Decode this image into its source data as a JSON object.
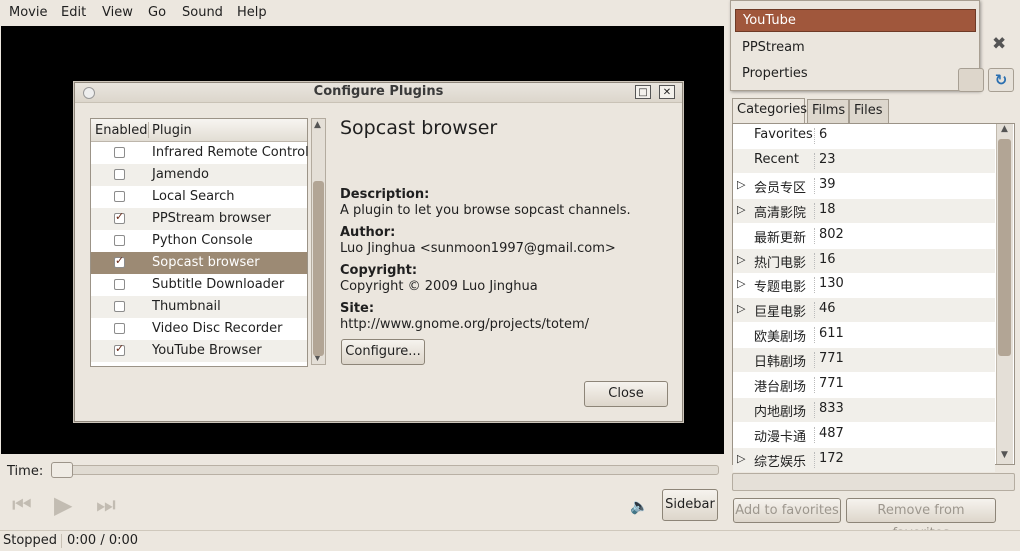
{
  "menubar": {
    "items": [
      "Movie",
      "Edit",
      "View",
      "Go",
      "Sound",
      "Help"
    ]
  },
  "dialog": {
    "title": "Configure Plugins",
    "list_headers": {
      "enabled": "Enabled",
      "plugin": "Plugin"
    },
    "plugins": [
      {
        "name": "Infrared Remote Control",
        "enabled": false
      },
      {
        "name": "Jamendo",
        "enabled": false
      },
      {
        "name": "Local Search",
        "enabled": false
      },
      {
        "name": "PPStream browser",
        "enabled": true
      },
      {
        "name": "Python Console",
        "enabled": false
      },
      {
        "name": "Sopcast browser",
        "enabled": true
      },
      {
        "name": "Subtitle Downloader",
        "enabled": false
      },
      {
        "name": "Thumbnail",
        "enabled": false
      },
      {
        "name": "Video Disc Recorder",
        "enabled": false
      },
      {
        "name": "YouTube Browser",
        "enabled": true
      }
    ],
    "selected_plugin": "Sopcast browser",
    "detail": {
      "title": "Sopcast browser",
      "description_label": "Description:",
      "description": "A plugin to let you browse sopcast channels.",
      "author_label": "Author:",
      "author": "Luo Jinghua <sunmoon1997@gmail.com>",
      "copyright_label": "Copyright:",
      "copyright": "Copyright © 2009 Luo Jinghua",
      "site_label": "Site:",
      "site": "http://www.gnome.org/projects/totem/"
    },
    "configure_button": "Configure...",
    "close_button": "Close"
  },
  "dropdown": {
    "items": [
      "YouTube",
      "PPStream",
      "Properties"
    ],
    "selected": "YouTube"
  },
  "sidebar": {
    "tabs": [
      "Categories",
      "Films",
      "Files"
    ],
    "active_tab": "Categories",
    "categories": [
      {
        "name": "Favorites",
        "count": "6",
        "expandable": false
      },
      {
        "name": "Recent",
        "count": "23",
        "expandable": false
      },
      {
        "name": "会员专区",
        "count": "39",
        "expandable": true
      },
      {
        "name": "高清影院",
        "count": "18",
        "expandable": true
      },
      {
        "name": "最新更新",
        "count": "802",
        "expandable": false
      },
      {
        "name": "热门电影",
        "count": "16",
        "expandable": true
      },
      {
        "name": "专题电影",
        "count": "130",
        "expandable": true
      },
      {
        "name": "巨星电影",
        "count": "46",
        "expandable": true
      },
      {
        "name": "欧美剧场",
        "count": "611",
        "expandable": false
      },
      {
        "name": "日韩剧场",
        "count": "771",
        "expandable": false
      },
      {
        "name": "港台剧场",
        "count": "771",
        "expandable": false
      },
      {
        "name": "内地剧场",
        "count": "833",
        "expandable": false
      },
      {
        "name": "动漫卡通",
        "count": "487",
        "expandable": false
      },
      {
        "name": "综艺娱乐",
        "count": "172",
        "expandable": true
      }
    ],
    "add_favorites": "Add to favorites",
    "remove_favorites": "Remove from favorites",
    "sidebar_button": "Sidebar"
  },
  "player": {
    "time_label": "Time:",
    "status": "Stopped",
    "time": "0:00 / 0:00",
    "seek_fraction": 0.0
  },
  "colors": {
    "accent": "#a0573c",
    "selection": "#9c8a74"
  }
}
